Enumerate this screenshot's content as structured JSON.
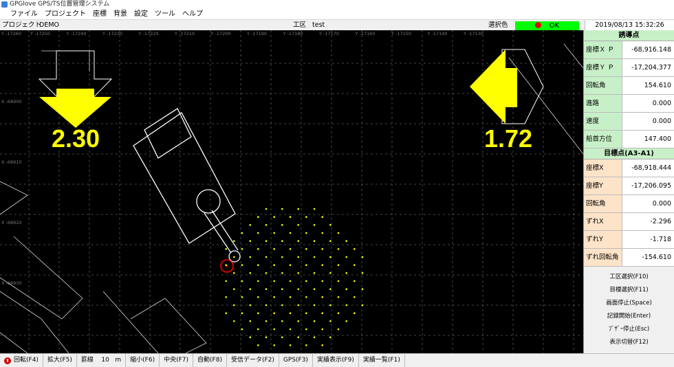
{
  "window": {
    "title": "GPGlove GPS/TS位置管理システム"
  },
  "menu": [
    "ファイル",
    "プロジェクト",
    "座標",
    "背景",
    "設定",
    "ツール",
    "ヘルプ"
  ],
  "infobar": {
    "project_label": "プロジェクト",
    "project_value": "DEMO",
    "area_label": "工区",
    "area_value": "test",
    "select_color_label": "選択色",
    "status": "OK",
    "datetime": "2019/08/13 15:32:26"
  },
  "canvas": {
    "top_axis_labels": [
      "Y -17260",
      "Y -17250",
      "Y -17240",
      "Y -17230",
      "Y -17220",
      "Y -17210",
      "Y -17200",
      "Y -17190",
      "Y -17180",
      "Y -17170",
      "Y -17160",
      "Y -17150",
      "Y -17140",
      "Y -17130"
    ],
    "left_axis_labels": [
      "X -68900",
      "X -68910",
      "X -68920",
      "X -68930"
    ],
    "left_arrow_value": "2.30",
    "right_arrow_value": "1.72",
    "colors": {
      "arrow": "#ffff00",
      "grid": "#5a5a5a",
      "lines": "#ffffff",
      "marker": "#ff0000",
      "points": "#ffff00"
    }
  },
  "guide_panel": {
    "title": "誘導点",
    "rows": [
      {
        "label": "座標Ｘ Ｐ",
        "value": "-68,916.148"
      },
      {
        "label": "座標Ｙ Ｐ",
        "value": "-17,204.377"
      },
      {
        "label": "回転角",
        "value": "154.610"
      },
      {
        "label": "進路",
        "value": "0.000"
      },
      {
        "label": "速度",
        "value": "0.000"
      },
      {
        "label": "船首方位",
        "value": "147.400"
      }
    ]
  },
  "target_panel": {
    "title": "目標点(A3-A1)",
    "rows": [
      {
        "label": "座標X",
        "value": "-68,918.444"
      },
      {
        "label": "座標Y",
        "value": "-17,206.095"
      },
      {
        "label": "回転角",
        "value": "0.000"
      },
      {
        "label": "ずれX",
        "value": "-2.296"
      },
      {
        "label": "ずれY",
        "value": "-1.718"
      },
      {
        "label": "ずれ回転角",
        "value": "-154.610"
      }
    ]
  },
  "panel_buttons": [
    "工区選択(F10)",
    "目標選択(F11)",
    "画面停止(Space)",
    "記録開始(Enter)",
    "ﾌﾞｻﾞｰ停止(Esc)",
    "表示切替(F12)"
  ],
  "toolbar": {
    "rotate": "回転(F4)",
    "zoom_in": "拡大(F5)",
    "grid_label": "罫線",
    "grid_value": "10",
    "grid_unit": "m",
    "zoom_out": "縮小(F6)",
    "center": "中央(F7)",
    "auto": "自動(F8)",
    "received_data": "受信データ(F2)",
    "gps": "GPS(F3)",
    "record_display": "実績表示(F9)",
    "record_list": "実績一覧(F1)"
  }
}
